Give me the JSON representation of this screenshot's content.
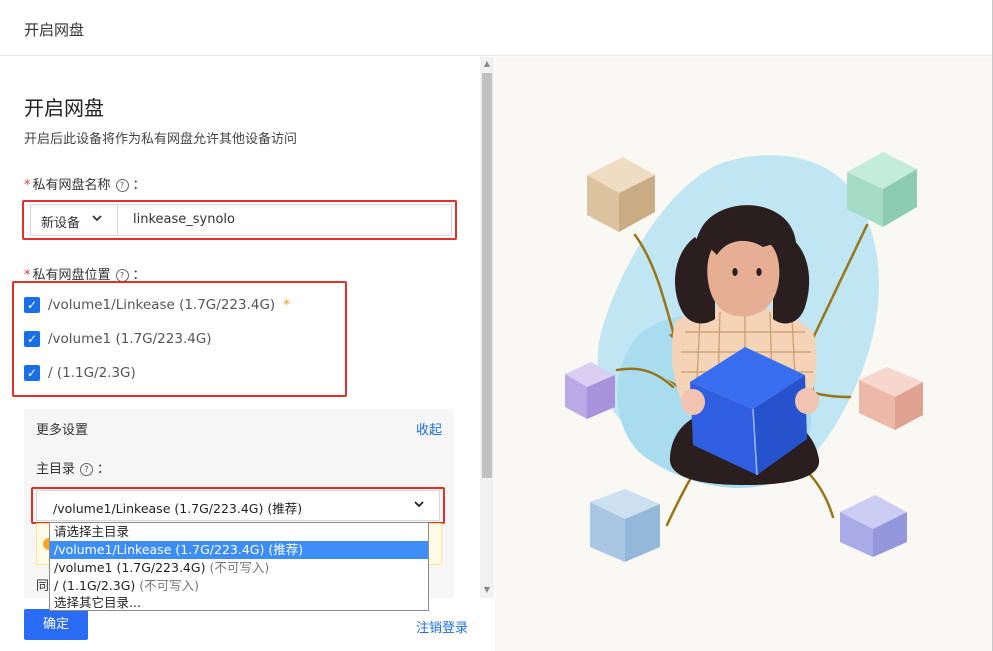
{
  "window": {
    "title": "开启网盘"
  },
  "form": {
    "heading": "开启网盘",
    "subtitle": "开启后此设备将作为私有网盘允许其他设备访问",
    "required_mark": "*",
    "help_icon_glyph": "?",
    "name_label": "私有网盘名称",
    "label_colon": "：",
    "name_prefix_value": "新设备",
    "name_input_value": "linkease_synolo",
    "location_label": "私有网盘位置",
    "locations": [
      {
        "label": "/volume1/Linkease (1.7G/223.4G)",
        "checked": true,
        "star": "*"
      },
      {
        "label": "/volume1 (1.7G/223.4G)",
        "checked": true,
        "star": ""
      },
      {
        "label": "/ (1.1G/2.3G)",
        "checked": true,
        "star": ""
      }
    ],
    "more_settings": {
      "title": "更多设置",
      "collapse_label": "收起",
      "main_dir_label": "主目录",
      "main_dir_value": "/volume1/Linkease (1.7G/223.4G) (推荐)",
      "hidden_text": "同"
    },
    "dropdown_options": [
      {
        "label": "请选择主目录",
        "suffix": ""
      },
      {
        "label": "/volume1/Linkease (1.7G/223.4G) (推荐)",
        "suffix": ""
      },
      {
        "label": "/volume1 (1.7G/223.4G)",
        "suffix": "(不可写入)"
      },
      {
        "label": "/ (1.1G/2.3G)",
        "suffix": "(不可写入)"
      },
      {
        "label": "选择其它目录...",
        "suffix": ""
      }
    ],
    "selected_option_index": 1,
    "confirm_label": "确定",
    "logout_label": "注销登录"
  },
  "icons": {
    "chevron_down": "chevron-down-icon",
    "checkbox_check": "check-icon",
    "scroll_up": "scroll-up-arrow-icon",
    "scroll_down": "scroll-down-arrow-icon"
  },
  "colors": {
    "accent": "#2b6cf6",
    "link": "#1a6fe6",
    "annotation_red": "#e0302a",
    "required": "#e23c3c",
    "dropdown_selected": "#3c8df5"
  }
}
